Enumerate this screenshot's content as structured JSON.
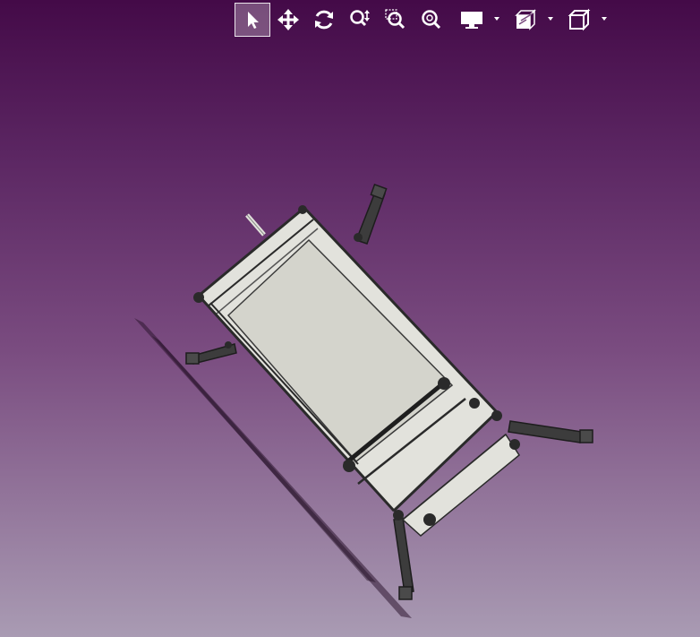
{
  "window": {
    "background_top": "#440a48",
    "background_bottom": "#a99bb3"
  },
  "toolbar": {
    "tools": [
      {
        "name": "select-tool",
        "icon": "cursor-arrow-icon",
        "active": true
      },
      {
        "name": "pan-tool",
        "icon": "pan-arrows-icon",
        "active": false
      },
      {
        "name": "orbit-tool",
        "icon": "orbit-rotate-icon",
        "active": false
      },
      {
        "name": "zoom-tool",
        "icon": "zoom-updown-icon",
        "active": false
      },
      {
        "name": "zoom-window-tool",
        "icon": "zoom-window-icon",
        "active": false
      },
      {
        "name": "zoom-fit-tool",
        "icon": "zoom-fit-icon",
        "active": false
      },
      {
        "name": "display-mode-menu",
        "icon": "monitor-icon",
        "active": false,
        "dropdown": true
      },
      {
        "name": "section-cut-menu",
        "icon": "section-plane-icon",
        "active": false,
        "dropdown": true
      },
      {
        "name": "view-orientation-menu",
        "icon": "cube-view-icon",
        "active": false,
        "dropdown": true
      }
    ],
    "icon_color": "#ffffff"
  },
  "model": {
    "description_icon": "cad-frame-assembly",
    "panel_color": "#d4d4cc",
    "frame_color": "#e2e2dc",
    "dark_part_color": "#2a2a2a"
  }
}
